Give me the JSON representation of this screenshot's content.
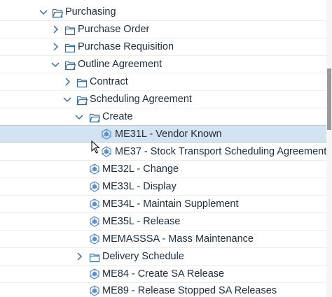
{
  "tree": {
    "items": [
      {
        "label": "Purchasing",
        "icon": "folder-open-icon",
        "expander": "expanded"
      },
      {
        "label": "Purchase Order",
        "icon": "folder-icon",
        "expander": "collapsed"
      },
      {
        "label": "Purchase Requisition",
        "icon": "folder-icon",
        "expander": "collapsed"
      },
      {
        "label": "Outline Agreement",
        "icon": "folder-open-icon",
        "expander": "expanded"
      },
      {
        "label": "Contract",
        "icon": "folder-icon",
        "expander": "collapsed"
      },
      {
        "label": "Scheduling Agreement",
        "icon": "folder-open-icon",
        "expander": "expanded"
      },
      {
        "label": "Create",
        "icon": "folder-open-icon",
        "expander": "expanded"
      },
      {
        "label": "ME31L - Vendor Known",
        "icon": "transaction-cube-icon",
        "selected": true
      },
      {
        "label": "ME37 - Stock Transport Scheduling Agreement",
        "icon": "transaction-cube-icon"
      },
      {
        "label": "ME32L - Change",
        "icon": "transaction-cube-icon"
      },
      {
        "label": "ME33L - Display",
        "icon": "transaction-cube-icon"
      },
      {
        "label": "ME34L - Maintain Supplement",
        "icon": "transaction-cube-icon"
      },
      {
        "label": "ME35L - Release",
        "icon": "transaction-cube-icon"
      },
      {
        "label": "MEMASSSA - Mass Maintenance",
        "icon": "transaction-cube-icon"
      },
      {
        "label": "Delivery Schedule",
        "icon": "folder-icon",
        "expander": "collapsed"
      },
      {
        "label": "ME84 - Create SA Release",
        "icon": "transaction-cube-icon"
      },
      {
        "label": "ME89 - Release Stopped SA Releases",
        "icon": "transaction-cube-icon"
      }
    ]
  },
  "colors": {
    "selected_row": "#d3e3f1",
    "text": "#1d2d3e",
    "icon": "#3b6e99",
    "transaction_icon": "#5b8fc7"
  }
}
